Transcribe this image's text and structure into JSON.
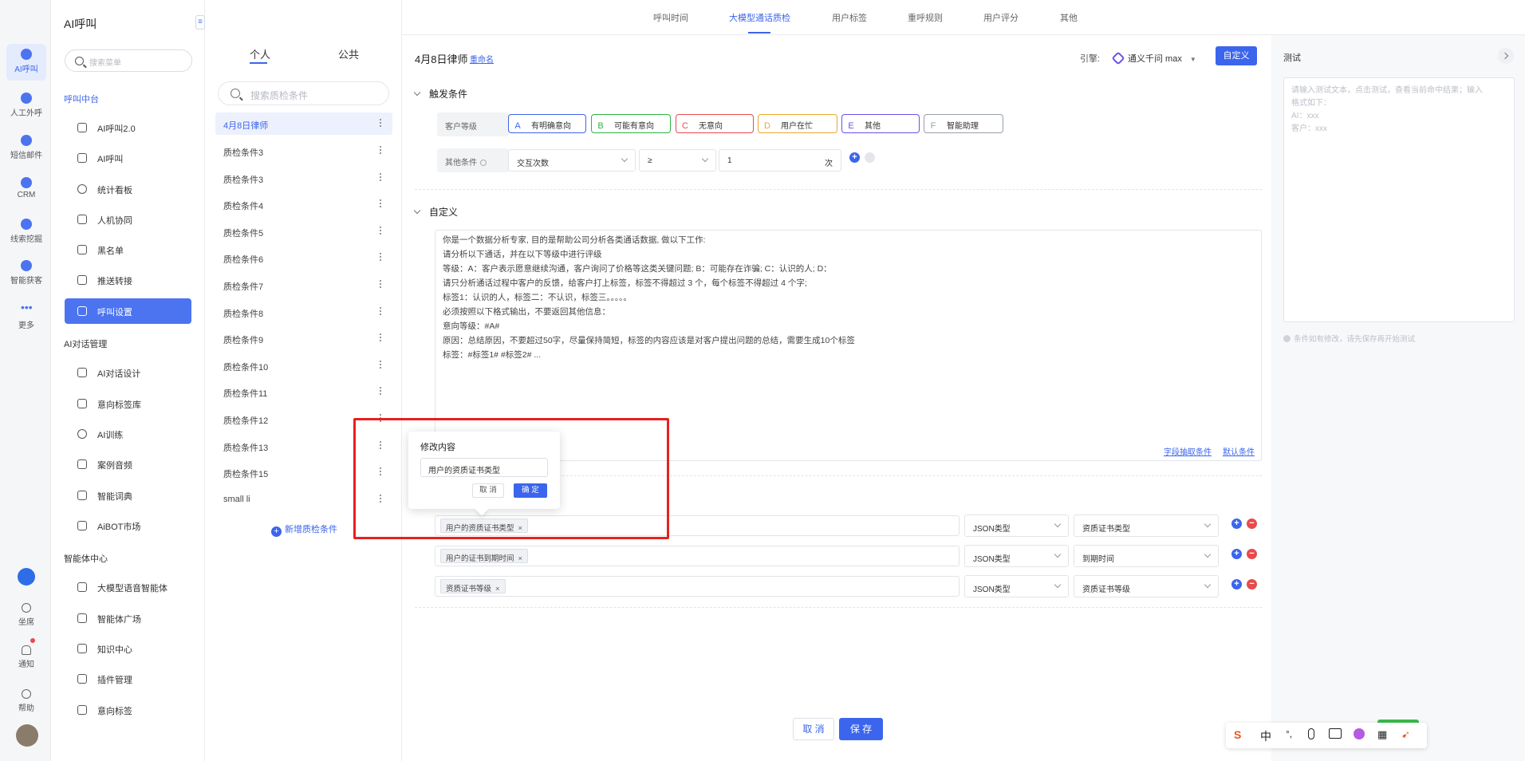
{
  "rail": {
    "items": [
      {
        "label": "AI呼叫",
        "active": true
      },
      {
        "label": "人工外呼"
      },
      {
        "label": "短信邮件"
      },
      {
        "label": "CRM"
      },
      {
        "label": "线索挖掘"
      },
      {
        "label": "智能获客"
      },
      {
        "label": "更多"
      }
    ],
    "bottom": [
      "坐席",
      "通知",
      "帮助"
    ]
  },
  "sidebar": {
    "brand": "AI呼叫",
    "search_placeholder": "搜索菜单",
    "sections": [
      {
        "title": "呼叫中台",
        "items": [
          "AI呼叫2.0",
          "AI呼叫",
          "统计看板",
          "人机协同",
          "黑名单",
          "推送转接",
          "呼叫设置"
        ]
      },
      {
        "title": "AI对话管理",
        "items": [
          "AI对话设计",
          "意向标签库",
          "AI训练",
          "案例音频",
          "智能词典",
          "AiBOT市场"
        ]
      },
      {
        "title": "智能体中心",
        "items": [
          "大模型语音智能体",
          "智能体广场",
          "知识中心",
          "插件管理",
          "意向标签"
        ]
      }
    ]
  },
  "list": {
    "tabs": [
      "个人",
      "公共"
    ],
    "search_placeholder": "搜索质检条件",
    "items": [
      "4月8日律师",
      "质检条件3",
      "质检条件3",
      "质检条件4",
      "质检条件5",
      "质检条件6",
      "质检条件7",
      "质检条件8",
      "质检条件9",
      "质检条件10",
      "质检条件11",
      "质检条件12",
      "质检条件13",
      "质检条件15",
      "small li"
    ],
    "add_label": "新增质检条件"
  },
  "toptabs": [
    "呼叫时间",
    "大模型通话质检",
    "用户标签",
    "重呼规则",
    "用户评分",
    "其他"
  ],
  "main": {
    "title": "4月8日律师",
    "rename": "重命名",
    "engine_label": "引擎:",
    "engine_value": "通义千问 max",
    "custom_button": "自定义",
    "trigger_title": "触发条件",
    "customer_level_label": "客户等级",
    "levels": [
      {
        "letter": "A",
        "label": "有明确意向",
        "color": "#3b65ec"
      },
      {
        "letter": "B",
        "label": "可能有意向",
        "color": "#2fb344"
      },
      {
        "letter": "C",
        "label": "无意向",
        "color": "#e84b4b"
      },
      {
        "letter": "D",
        "label": "用户在忙",
        "color": "#f0a62a"
      },
      {
        "letter": "E",
        "label": "其他",
        "color": "#6a50e8"
      },
      {
        "letter": "F",
        "label": "智能助理",
        "color": "#9aa0aa"
      }
    ],
    "other_label": "其他条件",
    "other_field": "交互次数",
    "other_op": "≥",
    "other_value": "1",
    "other_unit": "次",
    "custom_title": "自定义",
    "prompt_lines": [
      "你是一个数据分析专家, 目的是帮助公司分析各类通话数据, 做以下工作:",
      "请分析以下通话，并在以下等级中进行评级",
      "等级：A：客户表示愿意继续沟通，客户询问了价格等这类关键问题; B：可能存在诈骗; C：认识的人; D：",
      "请只分析通话过程中客户的反馈，给客户打上标签，标签不得超过 3 个，每个标签不得超过 4 个字;",
      "标签1：认识的人，标签二：不认识，标签三。。。。。",
      "必须按照以下格式输出，不要返回其他信息：",
      "意向等级：#A#",
      "原因：总结原因，不要超过50字，尽量保持简短，标签的内容应该是对客户提出问题的总结，需要生成10个标签",
      "标签：#标签1# #标签2# ..."
    ],
    "prompt_links": [
      "字段抽取条件",
      "默认条件"
    ],
    "fields": [
      {
        "chip": "用户的资质证书类型",
        "type": "JSON类型",
        "target": "资质证书类型"
      },
      {
        "chip": "用户的证书到期时间",
        "type": "JSON类型",
        "target": "到期时间"
      },
      {
        "chip": "资质证书等级",
        "type": "JSON类型",
        "target": "资质证书等级"
      }
    ],
    "cancel": "取 消",
    "save": "保 存"
  },
  "popover": {
    "title": "修改内容",
    "value": "用户的资质证书类型",
    "cancel": "取 消",
    "ok": "确 定"
  },
  "test": {
    "title": "测试",
    "placeholder_lines": [
      "请输入测试文本，点击测试，查看当前命中结果；输入",
      "格式如下：",
      "AI：xxx",
      "客户：xxx"
    ],
    "note": "条件如有修改，请先保存再开始测试"
  },
  "ime": [
    "中"
  ]
}
